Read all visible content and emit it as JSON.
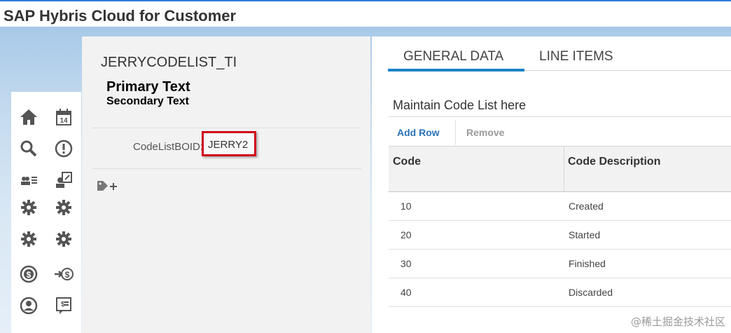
{
  "app": {
    "title": "SAP Hybris Cloud for Customer"
  },
  "sidebar": {
    "icons": [
      "home-icon",
      "calendar-icon",
      "search-icon",
      "alert-icon",
      "people-list-icon",
      "user-edit-icon",
      "settings-icon",
      "settings-icon",
      "settings-icon",
      "settings-icon",
      "dollar-icon",
      "transfer-dollar-icon",
      "user-circle-icon",
      "receipt-icon"
    ],
    "calendar_day": "14"
  },
  "object": {
    "title": "JERRYCODELIST_TI",
    "primary_text": "Primary Text",
    "secondary_text": "Secondary Text",
    "field_label": "CodeListBOID:",
    "field_value": "JERRY2",
    "tag_add_icon": "tag-add-icon"
  },
  "tabs": [
    {
      "label": "GENERAL DATA",
      "active": true
    },
    {
      "label": "LINE ITEMS",
      "active": false
    }
  ],
  "section": {
    "title": "Maintain Code List here",
    "add_row_label": "Add Row",
    "remove_label": "Remove"
  },
  "table": {
    "headers": [
      "Code",
      "Code Description"
    ],
    "rows": [
      {
        "code": "10",
        "description": "Created"
      },
      {
        "code": "20",
        "description": "Started"
      },
      {
        "code": "30",
        "description": "Finished"
      },
      {
        "code": "40",
        "description": "Discarded"
      }
    ]
  },
  "watermark": "@稀土掘金技术社区",
  "colors": {
    "accent": "#1b84c7",
    "highlight_box": "#d0021b",
    "link": "#2a74b8"
  }
}
